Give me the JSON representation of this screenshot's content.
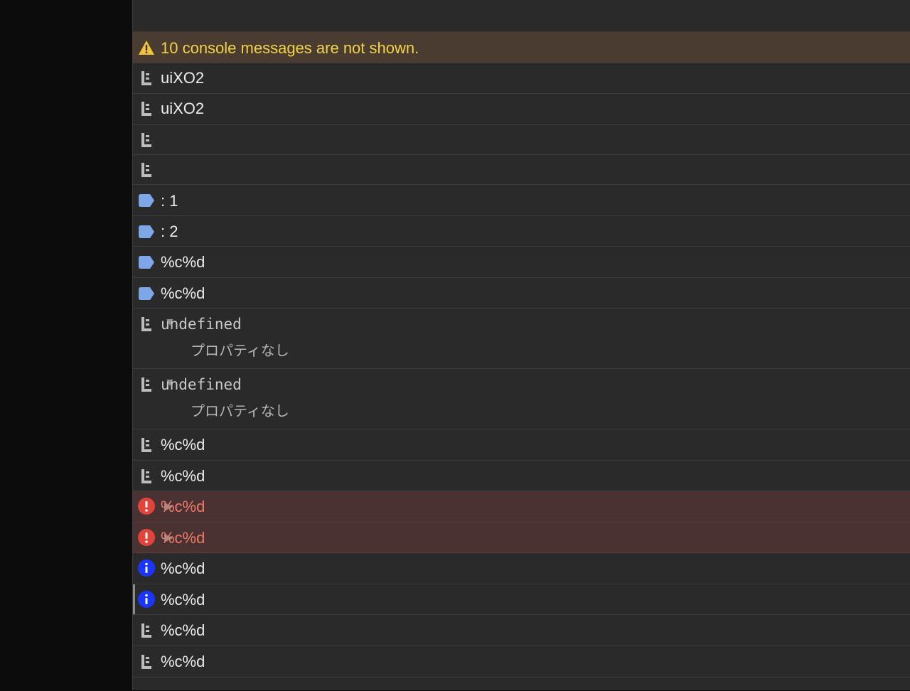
{
  "warning": {
    "text": "10 console messages are not shown.",
    "icon": "warning-triangle-icon",
    "color": "#f2d14b"
  },
  "rows": [
    {
      "kind": "log",
      "text": "uiXO2"
    },
    {
      "kind": "log",
      "text": "uiXO2"
    },
    {
      "kind": "log",
      "text": ""
    },
    {
      "kind": "log",
      "text": ""
    },
    {
      "kind": "label",
      "text": ": 1"
    },
    {
      "kind": "label",
      "text": ": 2"
    },
    {
      "kind": "label",
      "text": "%c%d"
    },
    {
      "kind": "label",
      "text": "%c%d"
    },
    {
      "kind": "object",
      "text": "undefined",
      "sub": "プロパティなし"
    },
    {
      "kind": "object",
      "text": "undefined",
      "sub": "プロパティなし"
    },
    {
      "kind": "log",
      "text": "%c%d"
    },
    {
      "kind": "log",
      "text": "%c%d"
    },
    {
      "kind": "error",
      "text": "%c%d"
    },
    {
      "kind": "error",
      "text": "%c%d"
    },
    {
      "kind": "info",
      "text": "%c%d"
    },
    {
      "kind": "info",
      "text": "%c%d"
    },
    {
      "kind": "log",
      "text": "%c%d"
    },
    {
      "kind": "log",
      "text": "%c%d"
    }
  ],
  "colors": {
    "error": "#e0443a",
    "info": "#1a35ff",
    "label": "#7da7e8",
    "log": "#bdbdbd"
  }
}
